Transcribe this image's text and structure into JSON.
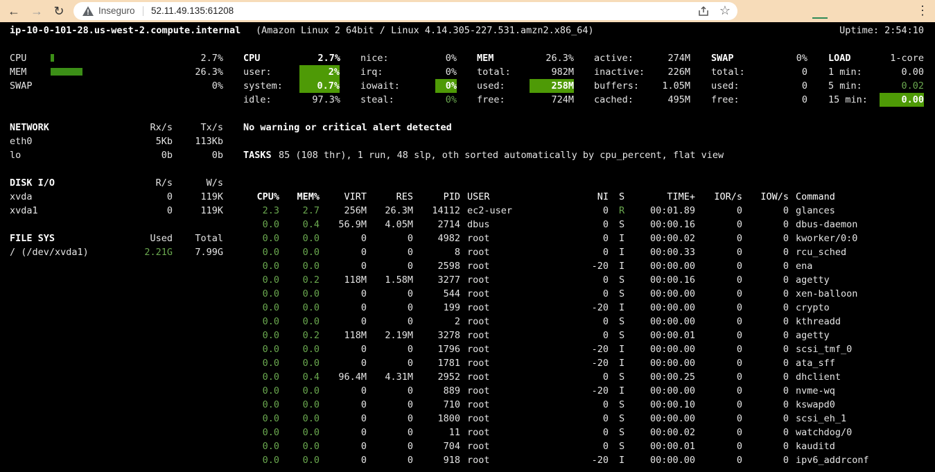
{
  "browser": {
    "security_label": "Inseguro",
    "url": "52.11.49.135:61208"
  },
  "header": {
    "hostname": "ip-10-0-101-28.us-west-2.compute.internal",
    "system_info": "(Amazon Linux 2 64bit / Linux 4.14.305-227.531.amzn2.x86_64)",
    "uptime": "Uptime: 2:54:10"
  },
  "quicklook": {
    "cpu": {
      "label": "CPU",
      "value": "2.7%",
      "percent": 2.7
    },
    "mem": {
      "label": "MEM",
      "value": "26.3%",
      "percent": 26.3
    },
    "swap": {
      "label": "SWAP",
      "value": "0%",
      "percent": 0
    }
  },
  "cpu": {
    "title": "CPU",
    "total": "2.7%",
    "user_label": "user:",
    "user": "2%",
    "system_label": "system:",
    "system": "0.7%",
    "idle_label": "idle:",
    "idle": "97.3%",
    "nice_label": "nice:",
    "nice": "0%",
    "irq_label": "irq:",
    "irq": "0%",
    "iowait_label": "iowait:",
    "iowait": "0%",
    "steal_label": "steal:",
    "steal": "0%"
  },
  "mem": {
    "title": "MEM",
    "total_pct": "26.3%",
    "total_label": "total:",
    "total": "982M",
    "used_label": "used:",
    "used": "258M",
    "free_label": "free:",
    "free": "724M",
    "active_label": "active:",
    "active": "274M",
    "inactive_label": "inactive:",
    "inactive": "226M",
    "buffers_label": "buffers:",
    "buffers": "1.05M",
    "cached_label": "cached:",
    "cached": "495M"
  },
  "swap": {
    "title": "SWAP",
    "pct": "0%",
    "total_label": "total:",
    "total": "0",
    "used_label": "used:",
    "used": "0",
    "free_label": "free:",
    "free": "0"
  },
  "load": {
    "title": "LOAD",
    "cores": "1-core",
    "min1_label": "1 min:",
    "min1": "0.00",
    "min5_label": "5 min:",
    "min5": "0.02",
    "min15_label": "15 min:",
    "min15": "0.00"
  },
  "network": {
    "title": "NETWORK",
    "rx_header": "Rx/s",
    "tx_header": "Tx/s",
    "rows": [
      {
        "iface": "eth0",
        "rx": "5Kb",
        "tx": "113Kb"
      },
      {
        "iface": "lo",
        "rx": "0b",
        "tx": "0b"
      }
    ]
  },
  "disk": {
    "title": "DISK I/O",
    "r_header": "R/s",
    "w_header": "W/s",
    "rows": [
      {
        "name": "xvda",
        "r": "0",
        "w": "119K"
      },
      {
        "name": "xvda1",
        "r": "0",
        "w": "119K"
      }
    ]
  },
  "filesys": {
    "title": "FILE SYS",
    "used_header": "Used",
    "total_header": "Total",
    "rows": [
      {
        "mount": "/ (/dev/xvda1)",
        "used": "2.21G",
        "total": "7.99G"
      }
    ]
  },
  "alert": "No warning or critical alert detected",
  "tasks": {
    "label": "TASKS",
    "summary": "85 (108 thr), 1 run, 48 slp, oth sorted automatically by cpu_percent, flat view"
  },
  "process_table": {
    "headers": {
      "cpu": "CPU%",
      "mem": "MEM%",
      "virt": "VIRT",
      "res": "RES",
      "pid": "PID",
      "user": "USER",
      "ni": "NI",
      "s": "S",
      "time": "TIME+",
      "ior": "IOR/s",
      "iow": "IOW/s",
      "cmd": "Command"
    },
    "rows": [
      {
        "cpu": "2.3",
        "mem": "2.7",
        "virt": "256M",
        "res": "26.3M",
        "pid": "14112",
        "user": "ec2-user",
        "ni": "0",
        "s": "R",
        "time": "00:01.89",
        "ior": "0",
        "iow": "0",
        "cmd": "glances"
      },
      {
        "cpu": "0.0",
        "mem": "0.4",
        "virt": "56.9M",
        "res": "4.05M",
        "pid": "2714",
        "user": "dbus",
        "ni": "0",
        "s": "S",
        "time": "00:00.16",
        "ior": "0",
        "iow": "0",
        "cmd": "dbus-daemon"
      },
      {
        "cpu": "0.0",
        "mem": "0.0",
        "virt": "0",
        "res": "0",
        "pid": "4982",
        "user": "root",
        "ni": "0",
        "s": "I",
        "time": "00:00.02",
        "ior": "0",
        "iow": "0",
        "cmd": "kworker/0:0"
      },
      {
        "cpu": "0.0",
        "mem": "0.0",
        "virt": "0",
        "res": "0",
        "pid": "8",
        "user": "root",
        "ni": "0",
        "s": "I",
        "time": "00:00.33",
        "ior": "0",
        "iow": "0",
        "cmd": "rcu_sched"
      },
      {
        "cpu": "0.0",
        "mem": "0.0",
        "virt": "0",
        "res": "0",
        "pid": "2598",
        "user": "root",
        "ni": "-20",
        "s": "I",
        "time": "00:00.00",
        "ior": "0",
        "iow": "0",
        "cmd": "ena"
      },
      {
        "cpu": "0.0",
        "mem": "0.2",
        "virt": "118M",
        "res": "1.58M",
        "pid": "3277",
        "user": "root",
        "ni": "0",
        "s": "S",
        "time": "00:00.16",
        "ior": "0",
        "iow": "0",
        "cmd": "agetty"
      },
      {
        "cpu": "0.0",
        "mem": "0.0",
        "virt": "0",
        "res": "0",
        "pid": "544",
        "user": "root",
        "ni": "0",
        "s": "S",
        "time": "00:00.00",
        "ior": "0",
        "iow": "0",
        "cmd": "xen-balloon"
      },
      {
        "cpu": "0.0",
        "mem": "0.0",
        "virt": "0",
        "res": "0",
        "pid": "199",
        "user": "root",
        "ni": "-20",
        "s": "I",
        "time": "00:00.00",
        "ior": "0",
        "iow": "0",
        "cmd": "crypto"
      },
      {
        "cpu": "0.0",
        "mem": "0.0",
        "virt": "0",
        "res": "0",
        "pid": "2",
        "user": "root",
        "ni": "0",
        "s": "S",
        "time": "00:00.00",
        "ior": "0",
        "iow": "0",
        "cmd": "kthreadd"
      },
      {
        "cpu": "0.0",
        "mem": "0.2",
        "virt": "118M",
        "res": "2.19M",
        "pid": "3278",
        "user": "root",
        "ni": "0",
        "s": "S",
        "time": "00:00.01",
        "ior": "0",
        "iow": "0",
        "cmd": "agetty"
      },
      {
        "cpu": "0.0",
        "mem": "0.0",
        "virt": "0",
        "res": "0",
        "pid": "1796",
        "user": "root",
        "ni": "-20",
        "s": "I",
        "time": "00:00.00",
        "ior": "0",
        "iow": "0",
        "cmd": "scsi_tmf_0"
      },
      {
        "cpu": "0.0",
        "mem": "0.0",
        "virt": "0",
        "res": "0",
        "pid": "1781",
        "user": "root",
        "ni": "-20",
        "s": "I",
        "time": "00:00.00",
        "ior": "0",
        "iow": "0",
        "cmd": "ata_sff"
      },
      {
        "cpu": "0.0",
        "mem": "0.4",
        "virt": "96.4M",
        "res": "4.31M",
        "pid": "2952",
        "user": "root",
        "ni": "0",
        "s": "S",
        "time": "00:00.25",
        "ior": "0",
        "iow": "0",
        "cmd": "dhclient"
      },
      {
        "cpu": "0.0",
        "mem": "0.0",
        "virt": "0",
        "res": "0",
        "pid": "889",
        "user": "root",
        "ni": "-20",
        "s": "I",
        "time": "00:00.00",
        "ior": "0",
        "iow": "0",
        "cmd": "nvme-wq"
      },
      {
        "cpu": "0.0",
        "mem": "0.0",
        "virt": "0",
        "res": "0",
        "pid": "710",
        "user": "root",
        "ni": "0",
        "s": "S",
        "time": "00:00.10",
        "ior": "0",
        "iow": "0",
        "cmd": "kswapd0"
      },
      {
        "cpu": "0.0",
        "mem": "0.0",
        "virt": "0",
        "res": "0",
        "pid": "1800",
        "user": "root",
        "ni": "0",
        "s": "S",
        "time": "00:00.00",
        "ior": "0",
        "iow": "0",
        "cmd": "scsi_eh_1"
      },
      {
        "cpu": "0.0",
        "mem": "0.0",
        "virt": "0",
        "res": "0",
        "pid": "11",
        "user": "root",
        "ni": "0",
        "s": "S",
        "time": "00:00.02",
        "ior": "0",
        "iow": "0",
        "cmd": "watchdog/0"
      },
      {
        "cpu": "0.0",
        "mem": "0.0",
        "virt": "0",
        "res": "0",
        "pid": "704",
        "user": "root",
        "ni": "0",
        "s": "S",
        "time": "00:00.01",
        "ior": "0",
        "iow": "0",
        "cmd": "kauditd"
      },
      {
        "cpu": "0.0",
        "mem": "0.0",
        "virt": "0",
        "res": "0",
        "pid": "918",
        "user": "root",
        "ni": "-20",
        "s": "I",
        "time": "00:00.00",
        "ior": "0",
        "iow": "0",
        "cmd": "ipv6_addrconf"
      }
    ]
  }
}
